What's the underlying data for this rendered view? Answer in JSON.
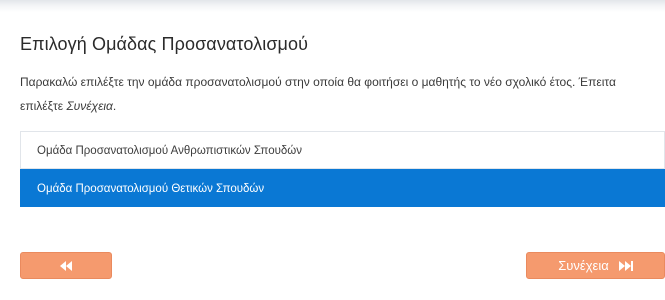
{
  "page": {
    "title": "Επιλογή Ομάδας Προσανατολισμού",
    "instructions_main": "Παρακαλώ επιλέξτε την ομάδα προσανατολισμού στην οποία θα φοιτήσει ο μαθητής το νέο σχολικό έτος. Έπειτα επιλέξτε ",
    "instructions_emphasis": "Συνέχεια",
    "instructions_end": "."
  },
  "options": [
    {
      "label": "Ομάδα Προσανατολισμού Ανθρωπιστικών Σπουδών",
      "selected": false
    },
    {
      "label": "Ομάδα Προσανατολισμού Θετικών Σπουδών",
      "selected": true
    }
  ],
  "buttons": {
    "back_icon": "fast-backward-icon",
    "next_label": "Συνέχεια",
    "next_icon": "fast-forward-icon"
  },
  "colors": {
    "accent_selected": "#0a78d4",
    "button_orange": "#f59a6e"
  }
}
